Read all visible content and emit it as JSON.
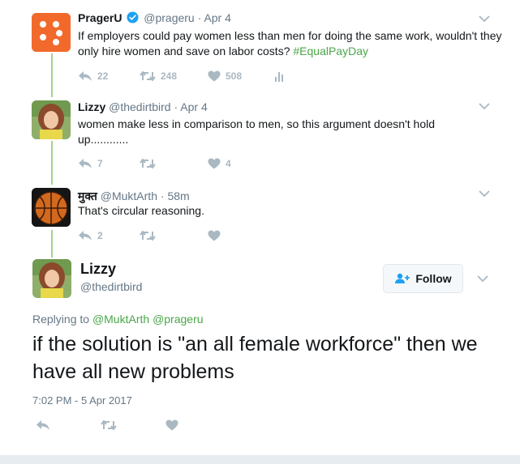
{
  "tweets": [
    {
      "name": "PragerU",
      "handle": "@prageru",
      "separator": "·",
      "time": "Apr 4",
      "text": "If employers could pay women less than men for doing the same work, wouldn't they only hire women and save on labor costs? ",
      "hashtag": "#EqualPayDay",
      "reply_count": "22",
      "retweet_count": "248",
      "like_count": "508",
      "verified": true
    },
    {
      "name": "Lizzy",
      "handle": "@thedirtbird",
      "separator": "·",
      "time": "Apr 4",
      "text": "women make less in comparison to men, so this argument doesn't hold up............",
      "reply_count": "7",
      "retweet_count": "",
      "like_count": "4"
    },
    {
      "name": "मुक्त",
      "handle": "@MuktArth",
      "separator": "·",
      "time": "58m",
      "text": "That's circular reasoning.",
      "reply_count": "2",
      "retweet_count": "",
      "like_count": ""
    }
  ],
  "main_tweet": {
    "name": "Lizzy",
    "handle": "@thedirtbird",
    "follow_label": "Follow",
    "replying_prefix": "Replying to ",
    "mention_1": "@MuktArth",
    "mention_2": "@prageru",
    "text": "if the solution is \"an all female workforce\" then we have all new problems",
    "timestamp": "7:02 PM - 5 Apr 2017"
  },
  "colors": {
    "accent_green": "#4aa64a",
    "thread_line": "#a6d28a",
    "icon_gray": "#aab8c2",
    "text_gray": "#657786",
    "prageru_orange": "#f26a2b"
  }
}
